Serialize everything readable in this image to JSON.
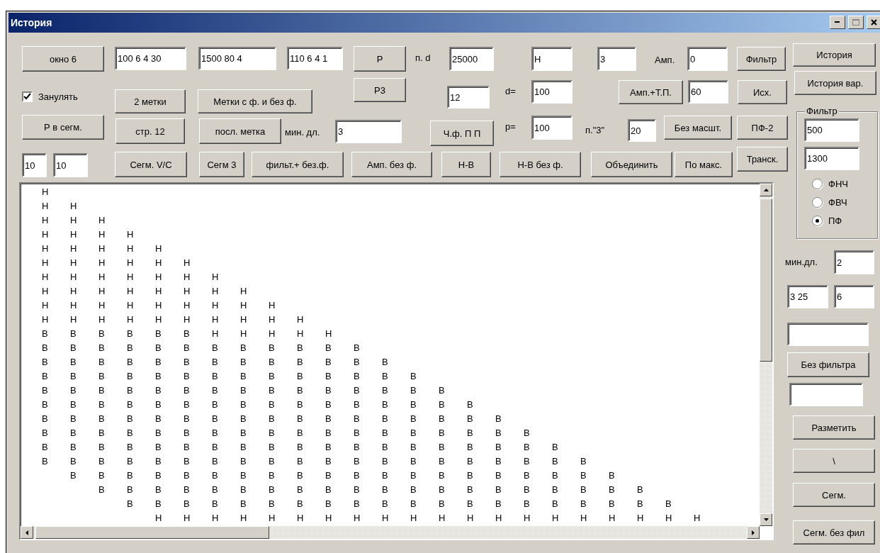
{
  "window": {
    "title": "История"
  },
  "controls": [
    {
      "kind": "button",
      "label": "окно 6"
    },
    {
      "kind": "field",
      "value": "100 6 4 30"
    },
    {
      "kind": "field",
      "value": "1500 80 4"
    },
    {
      "kind": "field",
      "value": "110 6 4 1"
    },
    {
      "kind": "button",
      "label": "Р"
    },
    {
      "kind": "label",
      "text": "п. d"
    },
    {
      "kind": "field",
      "value": "25000"
    },
    {
      "kind": "field",
      "value": "Н"
    },
    {
      "kind": "field",
      "value": "3"
    },
    {
      "kind": "label",
      "text": "Амп."
    },
    {
      "kind": "field",
      "value": "0"
    },
    {
      "kind": "button",
      "label": "Фильтр"
    },
    {
      "kind": "button",
      "label": "История"
    },
    {
      "kind": "checkbox",
      "label": "Занулять",
      "checked": true
    },
    {
      "kind": "button",
      "label": "Р3"
    },
    {
      "kind": "button",
      "label": "2 метки"
    },
    {
      "kind": "button",
      "label": "Метки с ф. и без ф."
    },
    {
      "kind": "field",
      "value": "12"
    },
    {
      "kind": "label",
      "text": "d="
    },
    {
      "kind": "field",
      "value": "100"
    },
    {
      "kind": "button",
      "label": "Амп.+Т.П."
    },
    {
      "kind": "field",
      "value": "60"
    },
    {
      "kind": "button",
      "label": "Исх."
    },
    {
      "kind": "button",
      "label": "История вар."
    },
    {
      "kind": "button",
      "label": "Р в сегм."
    },
    {
      "kind": "button",
      "label": "стр. 12"
    },
    {
      "kind": "button",
      "label": "посл. метка"
    },
    {
      "kind": "label",
      "text": "мин. дл."
    },
    {
      "kind": "field",
      "value": "3"
    },
    {
      "kind": "button",
      "label": "Ч.ф. П П"
    },
    {
      "kind": "label",
      "text": "р="
    },
    {
      "kind": "field",
      "value": "100"
    },
    {
      "kind": "label",
      "text": "п.\"3\""
    },
    {
      "kind": "field",
      "value": "20"
    },
    {
      "kind": "button",
      "label": "Без масшт."
    },
    {
      "kind": "button",
      "label": "ПФ-2"
    },
    {
      "kind": "field",
      "value": "10"
    },
    {
      "kind": "field",
      "value": "10"
    },
    {
      "kind": "button",
      "label": "Сегм. V/C"
    },
    {
      "kind": "button",
      "label": "Сегм 3"
    },
    {
      "kind": "button",
      "label": "фильт.+ без.ф."
    },
    {
      "kind": "button",
      "label": "Амп. без ф."
    },
    {
      "kind": "button",
      "label": "Н-В"
    },
    {
      "kind": "button",
      "label": "Н-В без ф."
    },
    {
      "kind": "button",
      "label": "Объединить"
    },
    {
      "kind": "button",
      "label": "По макс."
    },
    {
      "kind": "button",
      "label": "Транск."
    },
    {
      "kind": "group",
      "label": "Фильтр",
      "children": [
        {
          "kind": "field",
          "value": "500"
        },
        {
          "kind": "field",
          "value": "1300"
        },
        {
          "kind": "radio",
          "label": "ФНЧ",
          "selected": false
        },
        {
          "kind": "radio",
          "label": "ФВЧ",
          "selected": false
        },
        {
          "kind": "radio",
          "label": "ПФ",
          "selected": true
        }
      ]
    },
    {
      "kind": "label",
      "text": "мин.дл."
    },
    {
      "kind": "field",
      "value": "2"
    },
    {
      "kind": "field",
      "value": "3 25"
    },
    {
      "kind": "field",
      "value": "6"
    },
    {
      "kind": "field"
    },
    {
      "kind": "button",
      "label": "Без фильтра"
    },
    {
      "kind": "field"
    },
    {
      "kind": "button",
      "label": "Разметить"
    },
    {
      "kind": "button",
      "label": "\\"
    },
    {
      "kind": "button",
      "label": "Сегм."
    },
    {
      "kind": "button",
      "label": "Сегм. без фил"
    }
  ],
  "list": {
    "rows": [
      "Н",
      "Н\tН",
      "Н\tН\tН",
      "Н\tН\tН\tН",
      "Н\tН\tН\tН\tН",
      "Н\tН\tН\tН\tН\tН",
      "Н\tН\tН\tН\tН\tН\tН",
      "Н\tН\tН\tН\tН\tН\tН\tН",
      "Н\tН\tН\tН\tН\tН\tН\tН\tН",
      "Н\tН\tН\tН\tН\tН\tН\tН\tН\tН",
      "В\tВ\tВ\tВ\tВ\tВ\tН\tН\tН\tН\tН",
      "В\tВ\tВ\tВ\tВ\tВ\tВ\tВ\tВ\tВ\tВ\tВ",
      "В\tВ\tВ\tВ\tВ\tВ\tВ\tВ\tВ\tВ\tВ\tВ\tВ",
      "В\tВ\tВ\tВ\tВ\tВ\tВ\tВ\tВ\tВ\tВ\tВ\tВ\tВ",
      "В\tВ\tВ\tВ\tВ\tВ\tВ\tВ\tВ\tВ\tВ\tВ\tВ\tВ\tВ",
      "В\tВ\tВ\tВ\tВ\tВ\tВ\tВ\tВ\tВ\tВ\tВ\tВ\tВ\tВ\tВ",
      "В\tВ\tВ\tВ\tВ\tВ\tВ\tВ\tВ\tВ\tВ\tВ\tВ\tВ\tВ\tВ\tВ",
      "В\tВ\tВ\tВ\tВ\tВ\tВ\tВ\tВ\tВ\tВ\tВ\tВ\tВ\tВ\tВ\tВ\tВ",
      "В\tВ\tВ\tВ\tВ\tВ\tВ\tВ\tВ\tВ\tВ\tВ\tВ\tВ\tВ\tВ\tВ\tВ\tВ",
      "В\tВ\tВ\tВ\tВ\tВ\tВ\tВ\tВ\tВ\tВ\tВ\tВ\tВ\tВ\tВ\tВ\tВ\tВ\tВ",
      "\tВ\tВ\tВ\tВ\tВ\tВ\tВ\tВ\tВ\tВ\tВ\tВ\tВ\tВ\tВ\tВ\tВ\tВ\tВ\tВ",
      "\t\tВ\tВ\tВ\tВ\tВ\tВ\tВ\tВ\tВ\tВ\tВ\tВ\tВ\tВ\tВ\tВ\tВ\tВ\tВ\tВ",
      "\t\t\tВ\tВ\tВ\tВ\tВ\tВ\tВ\tВ\tВ\tВ\tВ\tВ\tВ\tВ\tВ\tВ\tВ\tВ\tВ\tВ",
      "\t\t\t\tН\tН\tН\tН\tН\tН\tН\tН\tН\tН\tН\tН\tН\tН\tН\tН\tН\tН\tН\tН"
    ]
  }
}
